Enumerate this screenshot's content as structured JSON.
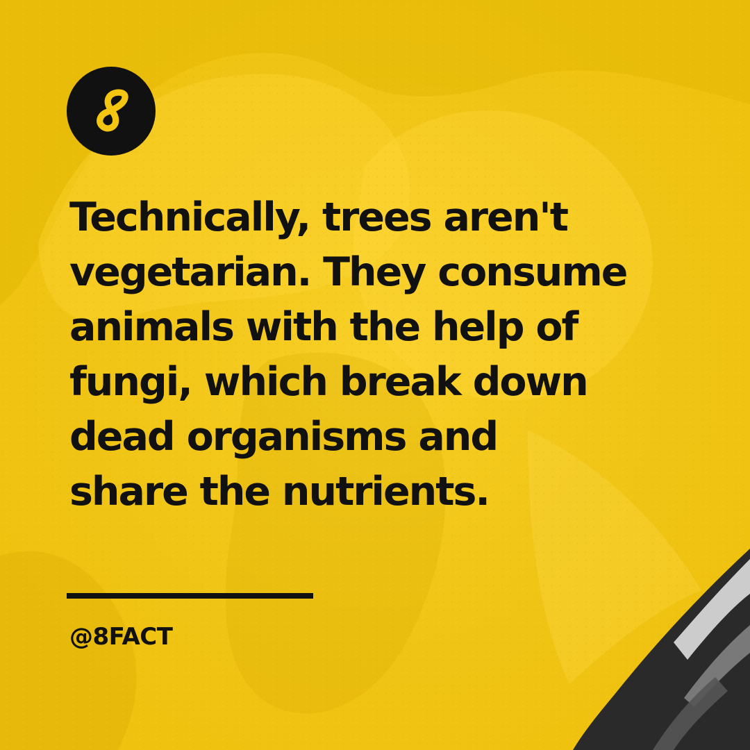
{
  "colors": {
    "background": "#f4c611",
    "text": "#111111",
    "logo": "#111111",
    "photo_shadow": "#d7aa00",
    "corner_photo": "#2a2a2a"
  },
  "icons": {
    "logo": "infinity-8-icon"
  },
  "post": {
    "fact": "Technically, trees aren't\nvegetarian. They consume\nanimals with the help of\nfungi, which break down\ndead organisms and\nshare the nutrients.",
    "handle": "@8FACT"
  }
}
